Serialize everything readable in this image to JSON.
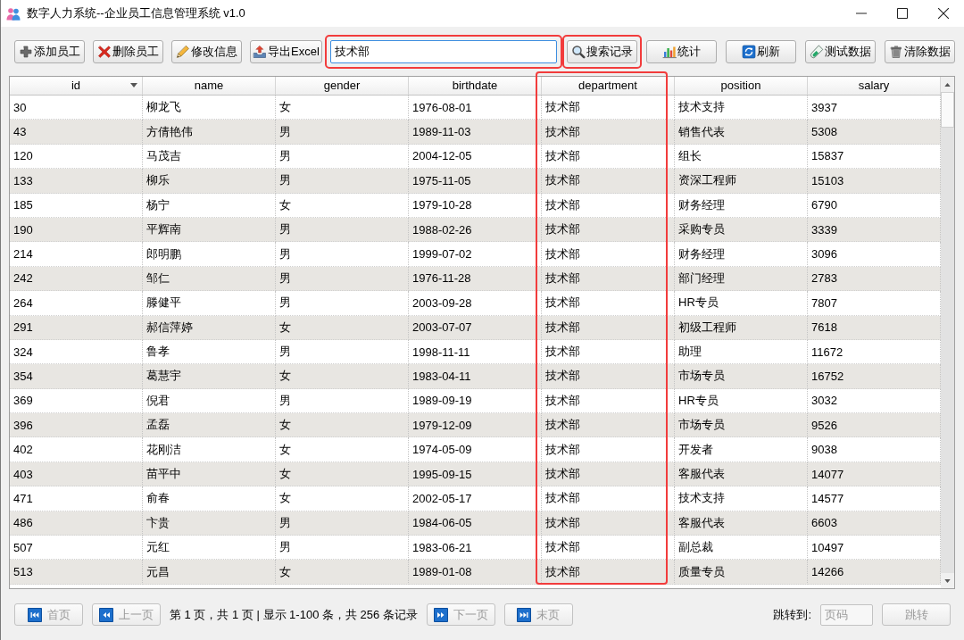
{
  "window": {
    "title": "数字人力系统--企业员工信息管理系统 v1.0"
  },
  "toolbar": {
    "buttons": [
      {
        "label": "添加员工",
        "kind": "add"
      },
      {
        "label": "删除员工",
        "kind": "delete"
      },
      {
        "label": "修改信息",
        "kind": "edit"
      },
      {
        "label": "导出Excel",
        "kind": "export"
      }
    ],
    "search_field": {
      "value": "技术部",
      "focused": true,
      "highlighted": true
    },
    "actions": [
      {
        "label": "搜索记录",
        "kind": "search",
        "highlighted": true
      },
      {
        "label": "统计",
        "kind": "stats",
        "highlighted": false
      },
      {
        "label": "刷新",
        "kind": "refresh",
        "highlighted": false
      },
      {
        "label": "测试数据",
        "kind": "test",
        "highlighted": false
      },
      {
        "label": "清除数据",
        "kind": "clear",
        "highlighted": false
      }
    ]
  },
  "table": {
    "columns": [
      {
        "label": "id",
        "sorted": true,
        "highlighted": false
      },
      {
        "label": "name",
        "sorted": false,
        "highlighted": false
      },
      {
        "label": "gender",
        "sorted": false,
        "highlighted": false
      },
      {
        "label": "birthdate",
        "sorted": false,
        "highlighted": false
      },
      {
        "label": "department",
        "sorted": false,
        "highlighted": true
      },
      {
        "label": "position",
        "sorted": false,
        "highlighted": false
      },
      {
        "label": "salary",
        "sorted": false,
        "highlighted": false
      }
    ],
    "rows": [
      [
        "30",
        "柳龙飞",
        "女",
        "1976-08-01",
        "技术部",
        "技术支持",
        "3937"
      ],
      [
        "43",
        "方倩艳伟",
        "男",
        "1989-11-03",
        "技术部",
        "销售代表",
        "5308"
      ],
      [
        "120",
        "马茂吉",
        "男",
        "2004-12-05",
        "技术部",
        "组长",
        "15837"
      ],
      [
        "133",
        "柳乐",
        "男",
        "1975-11-05",
        "技术部",
        "资深工程师",
        "15103"
      ],
      [
        "185",
        "杨宁",
        "女",
        "1979-10-28",
        "技术部",
        "财务经理",
        "6790"
      ],
      [
        "190",
        "平辉南",
        "男",
        "1988-02-26",
        "技术部",
        "采购专员",
        "3339"
      ],
      [
        "214",
        "郎明鹏",
        "男",
        "1999-07-02",
        "技术部",
        "财务经理",
        "3096"
      ],
      [
        "242",
        "邹仁",
        "男",
        "1976-11-28",
        "技术部",
        "部门经理",
        "2783"
      ],
      [
        "264",
        "滕健平",
        "男",
        "2003-09-28",
        "技术部",
        "HR专员",
        "7807"
      ],
      [
        "291",
        "郝信萍婷",
        "女",
        "2003-07-07",
        "技术部",
        "初级工程师",
        "7618"
      ],
      [
        "324",
        "鲁孝",
        "男",
        "1998-11-11",
        "技术部",
        "助理",
        "11672"
      ],
      [
        "354",
        "葛慧宇",
        "女",
        "1983-04-11",
        "技术部",
        "市场专员",
        "16752"
      ],
      [
        "369",
        "倪君",
        "男",
        "1989-09-19",
        "技术部",
        "HR专员",
        "3032"
      ],
      [
        "396",
        "孟磊",
        "女",
        "1979-12-09",
        "技术部",
        "市场专员",
        "9526"
      ],
      [
        "402",
        "花刚洁",
        "女",
        "1974-05-09",
        "技术部",
        "开发者",
        "9038"
      ],
      [
        "403",
        "苗平中",
        "女",
        "1995-09-15",
        "技术部",
        "客服代表",
        "14077"
      ],
      [
        "471",
        "俞春",
        "女",
        "2002-05-17",
        "技术部",
        "技术支持",
        "14577"
      ],
      [
        "486",
        "卞贵",
        "男",
        "1984-06-05",
        "技术部",
        "客服代表",
        "6603"
      ],
      [
        "507",
        "元红",
        "男",
        "1983-06-21",
        "技术部",
        "副总裁",
        "10497"
      ],
      [
        "513",
        "元昌",
        "女",
        "1989-01-08",
        "技术部",
        "质量专员",
        "14266"
      ]
    ]
  },
  "pagination": {
    "prev_buttons": [
      {
        "label": "首页",
        "kind": "first",
        "disabled": true
      },
      {
        "label": "上一页",
        "kind": "previous",
        "disabled": true
      }
    ],
    "info": "第 1 页，共 1 页 | 显示 1-100 条，共 256 条记录",
    "next_buttons": [
      {
        "label": "下一页",
        "kind": "next",
        "disabled": true
      },
      {
        "label": "末页",
        "kind": "last",
        "disabled": true
      }
    ],
    "jump": {
      "label": "跳转到:",
      "placeholder": "页码",
      "button": {
        "label": "跳转",
        "disabled": true
      }
    }
  }
}
